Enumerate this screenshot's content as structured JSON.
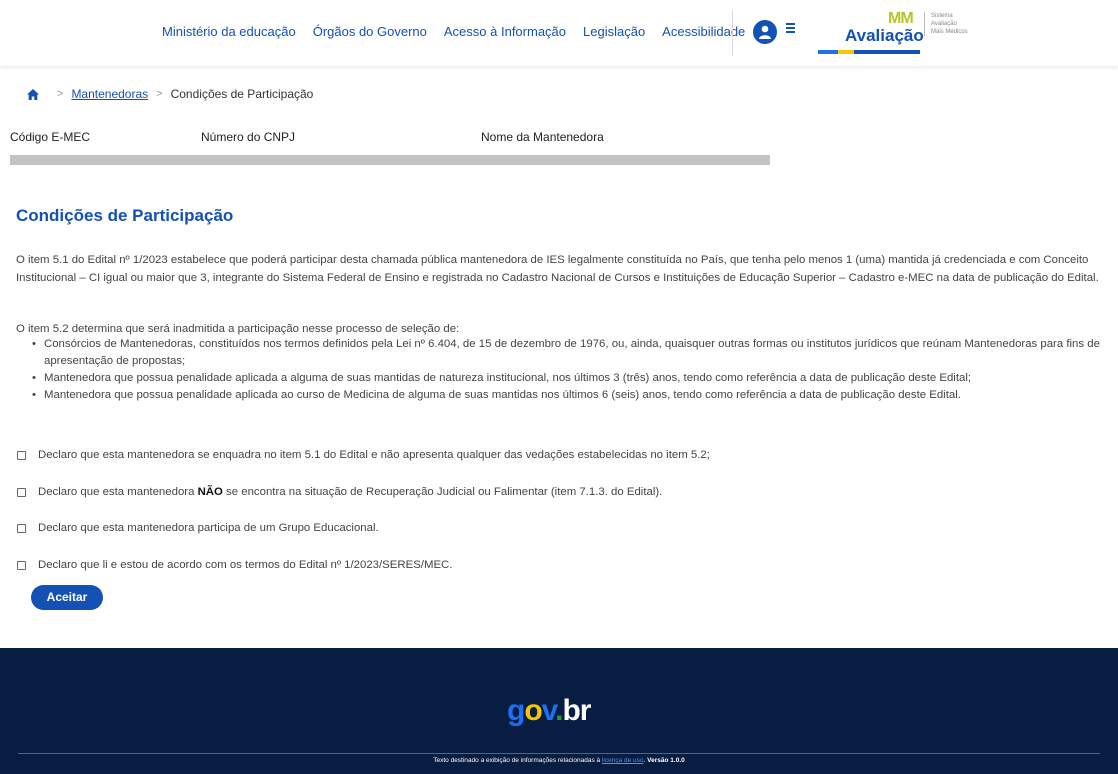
{
  "header": {
    "nav": [
      "Ministério da educação",
      "Órgãos do Governo",
      "Acesso à Informação",
      "Legislação",
      "Acessibilidade"
    ],
    "logo": {
      "mm": "MM",
      "name": "Avaliação",
      "subtitle_lines": [
        "Sistema",
        "Avaliação",
        "Mais Médicos"
      ]
    }
  },
  "breadcrumb": {
    "home_icon": "home-icon",
    "items": [
      "Mantenedoras",
      "Condições de Participação"
    ]
  },
  "info": {
    "columns": [
      "Código E-MEC",
      "Número do CNPJ",
      "Nome da Mantenedora"
    ]
  },
  "main": {
    "title": "Condições de Participação",
    "paragraph1": "O item 5.1 do Edital nº 1/2023 estabelece que poderá participar desta chamada pública mantenedora de IES legalmente constituída no País, que tenha pelo menos 1 (uma) mantida já credenciada e com Conceito Institucional – CI igual ou maior que 3, integrante do Sistema Federal de Ensino e registrada no Cadastro Nacional de Cursos e Instituições de Educação Superior – Cadastro e-MEC na data de publicação do Edital.",
    "paragraph2": "O item 5.2 determina que será inadmitida a participação nesse processo de seleção de:",
    "bullets": [
      "Consórcios de Mantenedoras, constituídos nos termos definidos pela Lei nº 6.404, de 15 de dezembro de 1976, ou, ainda, quaisquer outras formas ou institutos jurídicos que reúnam Mantenedoras para fins de apresentação de propostas;",
      "Mantenedora que possua penalidade aplicada a alguma de suas mantidas de natureza institucional, nos últimos 3 (três) anos, tendo como referência a data de publicação deste Edital;",
      "Mantenedora que possua penalidade aplicada ao curso de Medicina de alguma de suas mantidas nos últimos 6 (seis) anos, tendo como referência a data de publicação deste Edital."
    ],
    "checks": {
      "c1": "Declaro que esta mantenedora se enquadra no item 5.1 do Edital e não apresenta qualquer das vedações estabelecidas no item 5.2;",
      "c2_before": "Declaro que esta mantenedora ",
      "c2_bold": "NÃO",
      "c2_after": " se encontra na situação de Recuperação Judicial ou Falimentar (item 7.1.3. do Edital).",
      "c3": "Declaro que esta mantenedora participa de um Grupo Educacional.",
      "c4": "Declaro que li e estou de acordo com os termos do Edital nº 1/2023/SERES/MEC."
    },
    "accept_label": "Aceitar"
  },
  "footer": {
    "logo": {
      "g": "g",
      "o": "o",
      "v": "v",
      "dot": ".",
      "br": "br"
    },
    "text_before": "Texto destinado a exibição de informações relacionadas à ",
    "license_link": "licença de uso",
    "text_after": ". ",
    "version": "Versão 1.0.0"
  },
  "colors": {
    "primary": "#1351b4",
    "footer_bg": "#071d41",
    "logo_green": "#b6c42c"
  }
}
